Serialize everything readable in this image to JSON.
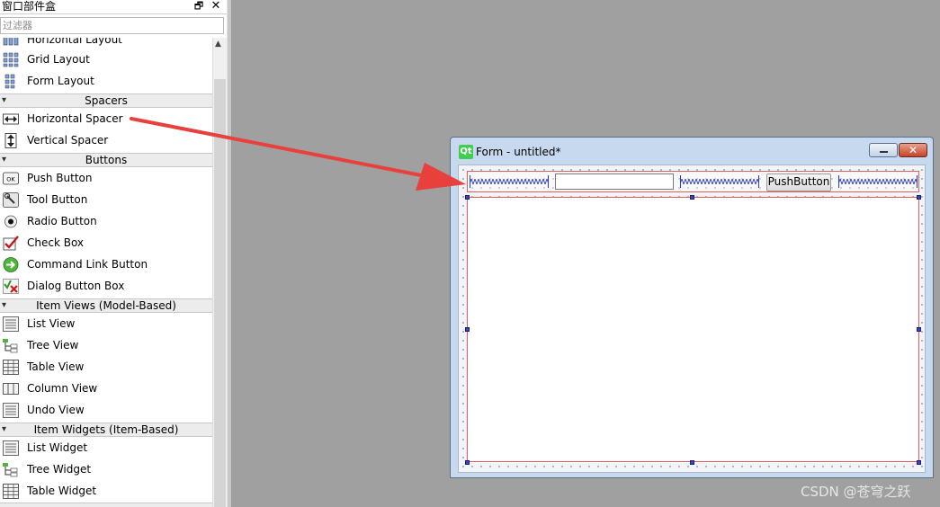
{
  "panel": {
    "title": "窗口部件盒",
    "filter_placeholder": "过滤器"
  },
  "widgets": {
    "layouts_partial": "Horizontal Layout",
    "grid_layout": "Grid Layout",
    "form_layout": "Form Layout",
    "cat_spacers": "Spacers",
    "horizontal_spacer": "Horizontal Spacer",
    "vertical_spacer": "Vertical Spacer",
    "cat_buttons": "Buttons",
    "push_button": "Push Button",
    "tool_button": "Tool Button",
    "radio_button": "Radio Button",
    "check_box": "Check Box",
    "command_link_button": "Command Link Button",
    "dialog_button_box": "Dialog Button Box",
    "cat_item_views": "Item Views (Model-Based)",
    "list_view": "List View",
    "tree_view": "Tree View",
    "table_view": "Table View",
    "column_view": "Column View",
    "undo_view": "Undo View",
    "cat_item_widgets": "Item Widgets (Item-Based)",
    "list_widget": "List Widget",
    "tree_widget": "Tree Widget",
    "table_widget": "Table Widget"
  },
  "form": {
    "title": "Form - untitled*",
    "push_button_label": "PushButton",
    "close_glyph": "✕"
  },
  "icons": {
    "float": "float-window-icon",
    "close": "close-icon",
    "qt_logo_text": "Qt"
  },
  "colors": {
    "selection_red": "#e06060",
    "handle_blue": "#3b48b0",
    "arrow_red": "#e8403c"
  },
  "watermark": "CSDN @苍穹之跃"
}
